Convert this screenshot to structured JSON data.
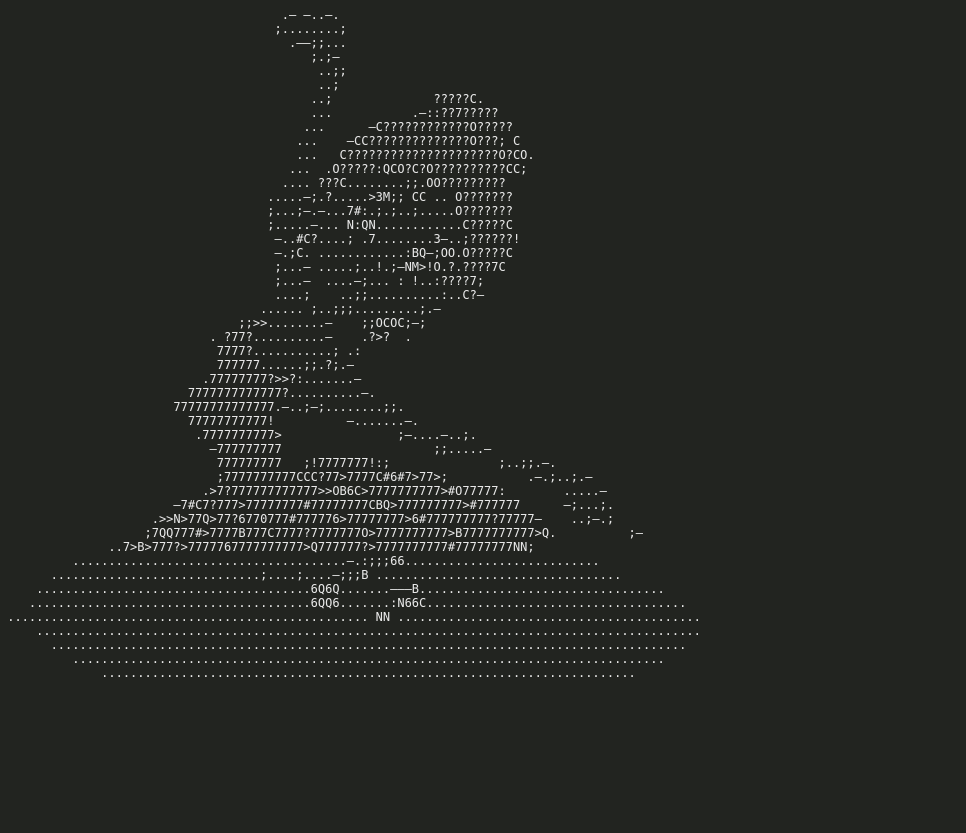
{
  "ascii_art": {
    "lines": [
      "                                       .– –..–.",
      "                                      ;........;",
      "                                        .––;;...",
      "                                           ;.;–",
      "                                            ..;;",
      "                                            ..;",
      "                                           ..;              ?????C.",
      "                                           ...           .–::??7?????",
      "                                          ...      –C????????????O?????",
      "                                         ...    –CC??????????????O???; C",
      "                                         ...   C?????????????????????O?CO.",
      "                                        ...  .O?????:QCO?C?O??????????CC;",
      "                                       .... ???C........;;.OO?????????",
      "                                     .....–;.?.....>3M;; CC .. O???????",
      "                                     ;...;–.–...7#:.;.;..;.....O???????",
      "                                     ;.....–... N:QN............C?????C",
      "                                      –..#C?....; .7........3–..;??????!",
      "                                      –.;C. ............:BQ–;OO.O?????C",
      "                                      ;...– .....;..!.;–NM>!O.?.????7C",
      "                                      ;...–  ....–;... : !..:????7;",
      "                                      ....;    ..;;..........:..C?–",
      "                                    ...... ;..;;;.........;.–",
      "                                 ;;>>........–    ;;OCOC;–;",
      "                             . ?77?..........–    .?>?  .",
      "                              7777?...........; .:",
      "                              777777......;;.?;.–",
      "                            .77777777?>>?:.......–",
      "                          7777777777777?..........–.",
      "                        77777777777777.–..;–;........;;.",
      "                          77777777777!          –.......–.",
      "                           .7777777777>                ;–....–..;.",
      "                             –777777777                     ;;.....–",
      "                              777777777   ;!7777777!:;               ;..;;.–.",
      "                              ;7777777777CCC?77>7777C#6#7>77>;           .–.;..;.–",
      "                            .>7?777777777777>>OB6C>7777777777>#O77777:        .....–",
      "                        –7#C7?777>77777777#77777777CBQ>777777777>#777777      –;...;.",
      "                     .>>N>77Q>77?6770777#777776>77777777>6#777777777?77777–    ..;–.;",
      "                    ;7QQ777#>7777B777C7777?7777777O>7777777777>B7777777777>Q.          ;–",
      "               ..7>B>777?>7777767777777777>Q777777?>7777777777#77777777NN;",
      "          ......................................–.:;;;66...........................",
      "       .............................;....;....–;;;B ..................................",
      "     ......................................6Q6Q.......–––B..................................",
      "    .......................................6QQ6.......:N66C....................................",
      " .................................................. NN ..........................................",
      "     ............................................................................................",
      "       ........................................................................................",
      "          ..................................................................................",
      "              .........................................................................."
    ]
  }
}
